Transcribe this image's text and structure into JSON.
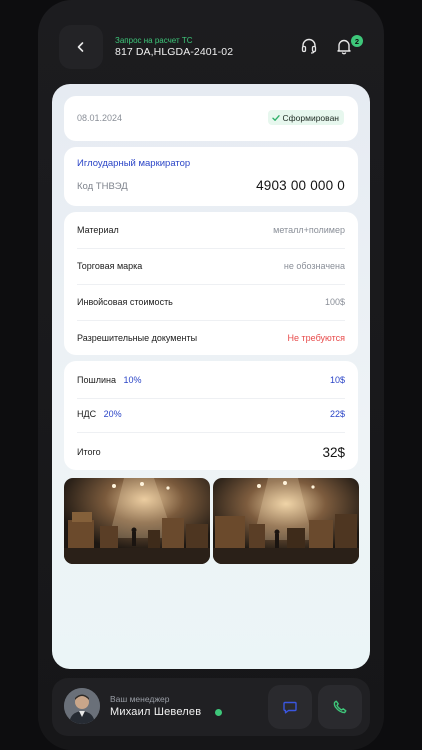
{
  "header": {
    "subtitle": "Запрос на расчет ТС",
    "title": "817 DA,HLGDA-2401-02",
    "notification_count": "2"
  },
  "summary": {
    "date": "08.01.2024",
    "status": "Сформирован"
  },
  "product": {
    "name": "Иглоударный маркиратор",
    "code_label": "Код ТНВЭД",
    "code_value": "4903 00 000 0"
  },
  "details": [
    {
      "label": "Материал",
      "value": "металл+полимер"
    },
    {
      "label": "Торговая марка",
      "value": "не обозначена"
    },
    {
      "label": "Инвойсовая стоимость",
      "value": "100$"
    },
    {
      "label": "Разрешительные документы",
      "value": "Не требуются"
    }
  ],
  "costs": {
    "duty_label": "Пошлина",
    "duty_pct": "10%",
    "duty_value": "10$",
    "vat_label": "НДС",
    "vat_pct": "20%",
    "vat_value": "22$",
    "total_label": "Итого",
    "total_value": "32$"
  },
  "manager": {
    "label": "Ваш менеджер",
    "name": "Михаил Шевелев"
  },
  "icons": {
    "back": "chevron-left-icon",
    "support": "headset-icon",
    "notifications": "bell-icon",
    "status": "check-icon",
    "chat": "chat-icon",
    "call": "phone-icon"
  },
  "colors": {
    "accent_green": "#3ec77a",
    "accent_blue": "#2b45c7",
    "warning_red": "#e84b4b"
  }
}
